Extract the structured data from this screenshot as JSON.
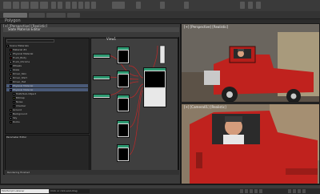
{
  "app": {
    "menu_items_count": 16
  },
  "tabs": [
    {
      "label": "Standard Modeling",
      "active": true
    },
    {
      "label": "Selection",
      "active": false
    },
    {
      "label": "Object Paint",
      "active": false
    }
  ],
  "document": {
    "title": "Polygon Modeling"
  },
  "viewports": {
    "left_label": "[+] [Perspective] [Realistic]",
    "top_right_label": "[+] [Perspective] [Realistic]",
    "bottom_right_label": "[+] [Camera01] [Realistic]"
  },
  "slate": {
    "title": "Slate Material Editor",
    "node_view_label": "View1",
    "browser_title": "Material/Map Browser",
    "param_title": "Parameter Editor",
    "status": "Rendering finished"
  },
  "browser_tree": [
    {
      "label": "Scene Materials",
      "color": "#888888",
      "indent": 0,
      "selected": false
    },
    {
      "label": "Material #1",
      "color": "#b03030",
      "indent": 1,
      "selected": false
    },
    {
      "label": "Physical Material",
      "color": "#c8c8c8",
      "indent": 1,
      "selected": false
    },
    {
      "label": "Truck_Body",
      "color": "#a02020",
      "indent": 1,
      "selected": false
    },
    {
      "label": "Truck_Chrome",
      "color": "#dddddd",
      "indent": 1,
      "selected": false
    },
    {
      "label": "Wheels",
      "color": "#202020",
      "indent": 1,
      "selected": false
    },
    {
      "label": "Glass",
      "color": "#7fb0d0",
      "indent": 1,
      "selected": false
    },
    {
      "label": "Driver_Skin",
      "color": "#c89070",
      "indent": 1,
      "selected": false
    },
    {
      "label": "Driver_Shirt",
      "color": "#e8e8e8",
      "indent": 1,
      "selected": false
    },
    {
      "label": "Driver_Hat",
      "color": "#333333",
      "indent": 1,
      "selected": false
    },
    {
      "label": "Physical Material",
      "color": "#5a5aff",
      "indent": 1,
      "selected": true
    },
    {
      "label": "Physical Material",
      "color": "#6a5ad8",
      "indent": 1,
      "selected": true
    },
    {
      "label": "Multi/Sub-Object",
      "color": "#a0a0a0",
      "indent": 2,
      "selected": false
    },
    {
      "label": "Bitmap",
      "color": "#90a040",
      "indent": 2,
      "selected": false
    },
    {
      "label": "Noise",
      "color": "#707070",
      "indent": 2,
      "selected": false
    },
    {
      "label": "Checker",
      "color": "#505050",
      "indent": 2,
      "selected": false
    },
    {
      "label": "Ground",
      "color": "#8a7a5a",
      "indent": 1,
      "selected": false
    },
    {
      "label": "Background",
      "color": "#606870",
      "indent": 1,
      "selected": false
    },
    {
      "label": "Sky",
      "color": "#9aa8b8",
      "indent": 1,
      "selected": false
    },
    {
      "label": "Rocks",
      "color": "#6a5a48",
      "indent": 1,
      "selected": false
    }
  ],
  "statusbar": {
    "script_listener": "MAXScript Listener",
    "status_field": "Click or click-and-drag"
  },
  "colors": {
    "node_header": "#2e9b73",
    "wire": "#c02828",
    "truck_red": "#c0221e",
    "selection": "#4a5a78"
  }
}
